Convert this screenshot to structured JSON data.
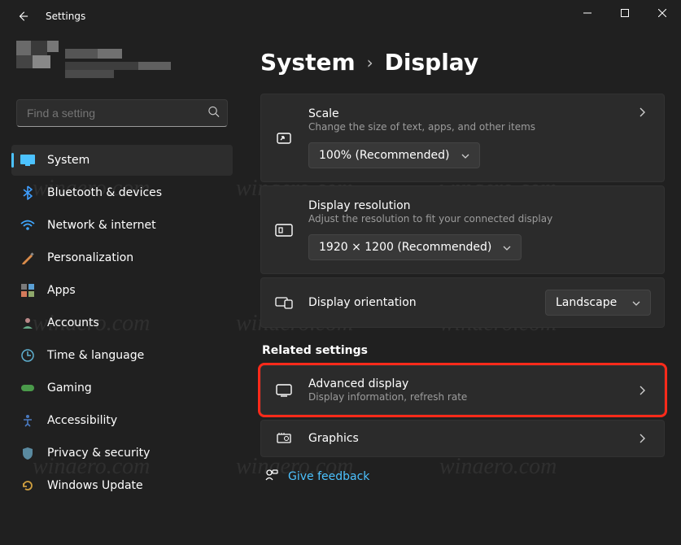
{
  "window": {
    "title": "Settings"
  },
  "search": {
    "placeholder": "Find a setting"
  },
  "sidebar": {
    "items": [
      {
        "label": "System"
      },
      {
        "label": "Bluetooth & devices"
      },
      {
        "label": "Network & internet"
      },
      {
        "label": "Personalization"
      },
      {
        "label": "Apps"
      },
      {
        "label": "Accounts"
      },
      {
        "label": "Time & language"
      },
      {
        "label": "Gaming"
      },
      {
        "label": "Accessibility"
      },
      {
        "label": "Privacy & security"
      },
      {
        "label": "Windows Update"
      }
    ]
  },
  "breadcrumb": {
    "parent": "System",
    "current": "Display"
  },
  "cards": {
    "scale": {
      "title": "Scale",
      "subtitle": "Change the size of text, apps, and other items",
      "value": "100% (Recommended)"
    },
    "resolution": {
      "title": "Display resolution",
      "subtitle": "Adjust the resolution to fit your connected display",
      "value": "1920 × 1200 (Recommended)"
    },
    "orientation": {
      "title": "Display orientation",
      "value": "Landscape"
    },
    "related_header": "Related settings",
    "advanced": {
      "title": "Advanced display",
      "subtitle": "Display information, refresh rate"
    },
    "graphics": {
      "title": "Graphics"
    }
  },
  "feedback": {
    "label": "Give feedback"
  },
  "watermark": "winaero.com"
}
